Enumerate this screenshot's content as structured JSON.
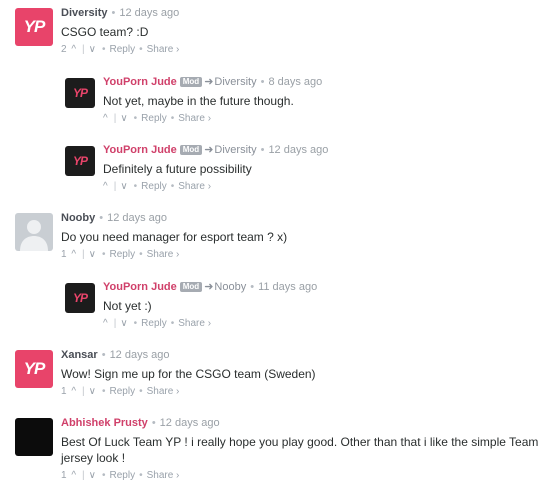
{
  "comments": [
    {
      "author": "Diversity",
      "time": "12 days ago",
      "text": "CSGO team? :D",
      "votes": "2",
      "avatar_text": "YP",
      "reply_label": "Reply",
      "share_label": "Share ›"
    },
    {
      "author": "YouPorn Jude",
      "badge": "Mod",
      "parent": "Diversity",
      "time": "8 days ago",
      "text": "Not yet, maybe in the future though.",
      "avatar_text": "YP",
      "reply_label": "Reply",
      "share_label": "Share ›"
    },
    {
      "author": "YouPorn Jude",
      "badge": "Mod",
      "parent": "Diversity",
      "time": "12 days ago",
      "text": "Definitely a future possibility",
      "avatar_text": "YP",
      "reply_label": "Reply",
      "share_label": "Share ›"
    },
    {
      "author": "Nooby",
      "time": "12 days ago",
      "text": "Do you need manager for esport team ? x)",
      "votes": "1",
      "reply_label": "Reply",
      "share_label": "Share ›"
    },
    {
      "author": "YouPorn Jude",
      "badge": "Mod",
      "parent": "Nooby",
      "time": "11 days ago",
      "text": "Not yet :)",
      "avatar_text": "YP",
      "reply_label": "Reply",
      "share_label": "Share ›"
    },
    {
      "author": "Xansar",
      "time": "12 days ago",
      "text": "Wow! Sign me up for the CSGO team (Sweden)",
      "votes": "1",
      "avatar_text": "YP",
      "reply_label": "Reply",
      "share_label": "Share ›"
    },
    {
      "author": "Abhishek Prusty",
      "time": "12 days ago",
      "text": "Best Of Luck Team YP ! i really hope you play good. Other than that i like the simple Team jersey look !",
      "votes": "1",
      "reply_label": "Reply",
      "share_label": "Share ›"
    }
  ],
  "ui": {
    "upvote_icon": "^",
    "downvote_icon": "∨",
    "dot": "•",
    "reply_arrow": "➜"
  },
  "colors": {
    "brand_pink": "#e8446a",
    "mod_name": "#d0406a"
  }
}
